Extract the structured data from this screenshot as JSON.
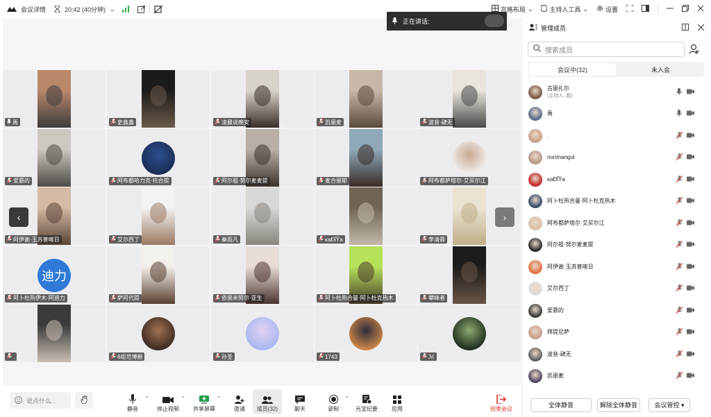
{
  "topbar": {
    "meeting_details": "会议详情",
    "timer": "20:42 (40分钟)",
    "grid_layout": "宫格布局",
    "host_tools": "主持人工具",
    "settings": "设置"
  },
  "speaking": {
    "label": "正在讲话:"
  },
  "tiles": [
    {
      "name": "禹",
      "type": "video",
      "c1": "#b9876a",
      "c2": "#3c3c3c",
      "mic": "on"
    },
    {
      "name": "史鑫鑫",
      "type": "video",
      "c1": "#1b1b1b",
      "c2": "#6b5a4a",
      "mic": "off"
    },
    {
      "name": "凌晨说晚安",
      "type": "video",
      "c1": "#d8d2cc",
      "c2": "#3a2e2a",
      "mic": "off"
    },
    {
      "name": "凯丽麦",
      "type": "video",
      "c1": "#c9b8a8",
      "c2": "#5b4b3c",
      "mic": "off"
    },
    {
      "name": "波音·肆无",
      "type": "video",
      "c1": "#e9e4dd",
      "c2": "#4a4a4a",
      "mic": "off"
    },
    {
      "name": "爱慕的",
      "type": "video",
      "c1": "#ccc7c0",
      "c2": "#4e4a45",
      "mic": "off"
    },
    {
      "name": "阿布都哈力克·托合提",
      "type": "avatar",
      "c1": "#1b2c54",
      "c2": "#2d4f8f",
      "mic": "off"
    },
    {
      "name": "阿尔祖·努尔麦麦提",
      "type": "video",
      "c1": "#b8b0a6",
      "c2": "#3c322c",
      "mic": "off"
    },
    {
      "name": "麦合丽耶",
      "type": "video",
      "c1": "#8fa9b8",
      "c2": "#3a2b28",
      "mic": "off"
    },
    {
      "name": "阿布都萨塔尔·艾买尔江",
      "type": "avatar",
      "c1": "#f0f0f0",
      "c2": "#c9a88f",
      "mic": "off"
    },
    {
      "name": "阿伊谢·玉苏普喀日",
      "type": "video",
      "c1": "#d4b9a4",
      "c2": "#5a4638",
      "mic": "off"
    },
    {
      "name": "艾尔西丁",
      "type": "video",
      "c1": "#f3f3f3",
      "c2": "#9b7a62",
      "mic": "off"
    },
    {
      "name": "秦雨凡",
      "type": "video",
      "c1": "#d8d8d6",
      "c2": "#8a857e",
      "mic": "off"
    },
    {
      "name": "κaÐῗŶa",
      "type": "video",
      "c1": "#6f6455",
      "c2": "#c2b9aa",
      "mic": "off"
    },
    {
      "name": "李清霖",
      "type": "video",
      "c1": "#eae3d2",
      "c2": "#bfae88",
      "mic": "off"
    },
    {
      "name": "阿卜杜热伊木·阿迪力",
      "type": "text",
      "text": "迪力",
      "c1": "#2f7ad9",
      "mic": "off"
    },
    {
      "name": "萨阿代提",
      "type": "video",
      "c1": "#f4f0ec",
      "c2": "#5a4030",
      "mic": "off"
    },
    {
      "name": "依丽米努尔·亚生",
      "type": "video",
      "c1": "#e8dcd8",
      "c2": "#4a3330",
      "mic": "off"
    },
    {
      "name": "阿卜杜热合曼·阿卜杜克热木",
      "type": "video",
      "c1": "#b6e25a",
      "c2": "#4a3a2c",
      "mic": "off"
    },
    {
      "name": "攀峰者",
      "type": "video",
      "c1": "#1c1c1c",
      "c2": "#6a5446",
      "mic": "off"
    },
    {
      "name": ".",
      "type": "video",
      "c1": "#3b3b3b",
      "c2": "#c8beb4",
      "mic": "off"
    },
    {
      "name": "6组范博爵",
      "type": "avatar",
      "c1": "#3a2a22",
      "c2": "#a07050",
      "mic": "off"
    },
    {
      "name": "孙圣",
      "type": "avatar",
      "c1": "#a8b6f0",
      "c2": "#e0d2f2",
      "mic": "off"
    },
    {
      "name": "1743",
      "type": "avatar",
      "c1": "#d08848",
      "c2": "#2c2c3c",
      "mic": "off"
    },
    {
      "name": "ℳ",
      "type": "avatar",
      "c1": "#1e2a1e",
      "c2": "#8aa870",
      "mic": "off"
    }
  ],
  "bottom": {
    "say_placeholder": "说点什么...",
    "mute": "静音",
    "stop_video": "停止视频",
    "share_screen": "共享屏幕",
    "invite": "邀请",
    "members": "成员(32)",
    "chat": "聊天",
    "record": "录制",
    "ai_minutes": "元宝纪要",
    "apps": "应用",
    "end": "结束会议"
  },
  "panel": {
    "title": "管理成员",
    "search_placeholder": "搜索成员",
    "tab_in": "会议中(32)",
    "tab_not": "未入会",
    "members": [
      {
        "name": "古丽扎尔",
        "sub": "(主持人, 我)",
        "c1": "#7a5a44",
        "mic": "on"
      },
      {
        "name": "禹",
        "sub": "",
        "c1": "#5a6a8a",
        "mic": "on"
      },
      {
        "name": ".",
        "sub": "",
        "c1": "#caa088",
        "mic": "off"
      },
      {
        "name": "nurimangul",
        "sub": "",
        "c1": "#b89888",
        "mic": "off"
      },
      {
        "name": "κaÐῗŶa",
        "sub": "",
        "c1": "#c0282a",
        "mic": "off"
      },
      {
        "name": "阿卜杜热合曼·阿卜杜克热木",
        "sub": "",
        "c1": "#3a4a6a",
        "mic": "off"
      },
      {
        "name": "阿布都萨塔尔·艾买尔江",
        "sub": "",
        "c1": "#d8c0a8",
        "mic": "off"
      },
      {
        "name": "阿尔祖·努尔麦麦提",
        "sub": "",
        "c1": "#2a2a2a",
        "mic": "off"
      },
      {
        "name": "阿伊谢·玉苏普喀日",
        "sub": "",
        "c1": "#e07040",
        "mic": "off"
      },
      {
        "name": "艾尔西丁",
        "sub": "",
        "c1": "#dcdcdc",
        "mic": "off"
      },
      {
        "name": "爱慕的",
        "sub": "",
        "c1": "#3a3a3a",
        "mic": "off"
      },
      {
        "name": "拜提尼萨",
        "sub": "",
        "c1": "#c8a088",
        "mic": "off"
      },
      {
        "name": "波音·肆无",
        "sub": "",
        "c1": "#606060",
        "mic": "off"
      },
      {
        "name": "凯丽麦",
        "sub": "",
        "c1": "#504860",
        "mic": "off"
      }
    ],
    "mute_all": "全体静音",
    "unmute_all": "解除全体静音",
    "meeting_control": "会议管控 ▾"
  }
}
